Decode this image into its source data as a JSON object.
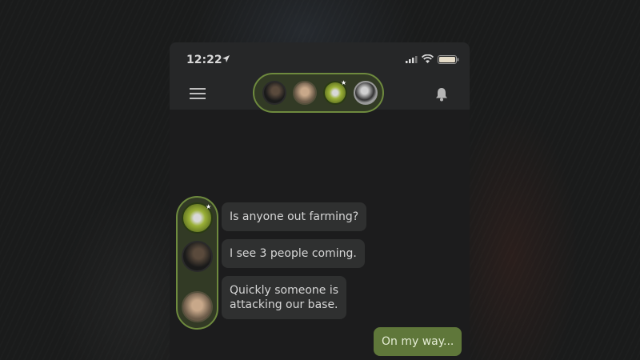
{
  "status_bar": {
    "time": "12:22"
  },
  "header": {
    "participants": [
      {
        "name": "participant-1",
        "style": "dark"
      },
      {
        "name": "participant-2",
        "style": "tan"
      },
      {
        "name": "participant-3",
        "style": "green",
        "badge": "★"
      },
      {
        "name": "participant-4",
        "style": "bw"
      }
    ]
  },
  "messages": [
    {
      "text": "Is anyone out farming?",
      "mine": false
    },
    {
      "text": "I see 3 people coming.",
      "mine": false
    },
    {
      "text": "Quickly someone is",
      "text2": "attacking our base.",
      "mine": false
    },
    {
      "text": "On my way...",
      "mine": true
    }
  ],
  "sender_badge": "★",
  "colors": {
    "accent": "#6e8a3e",
    "mine_bubble": "#5f773a",
    "bubble": "#2f3030"
  }
}
